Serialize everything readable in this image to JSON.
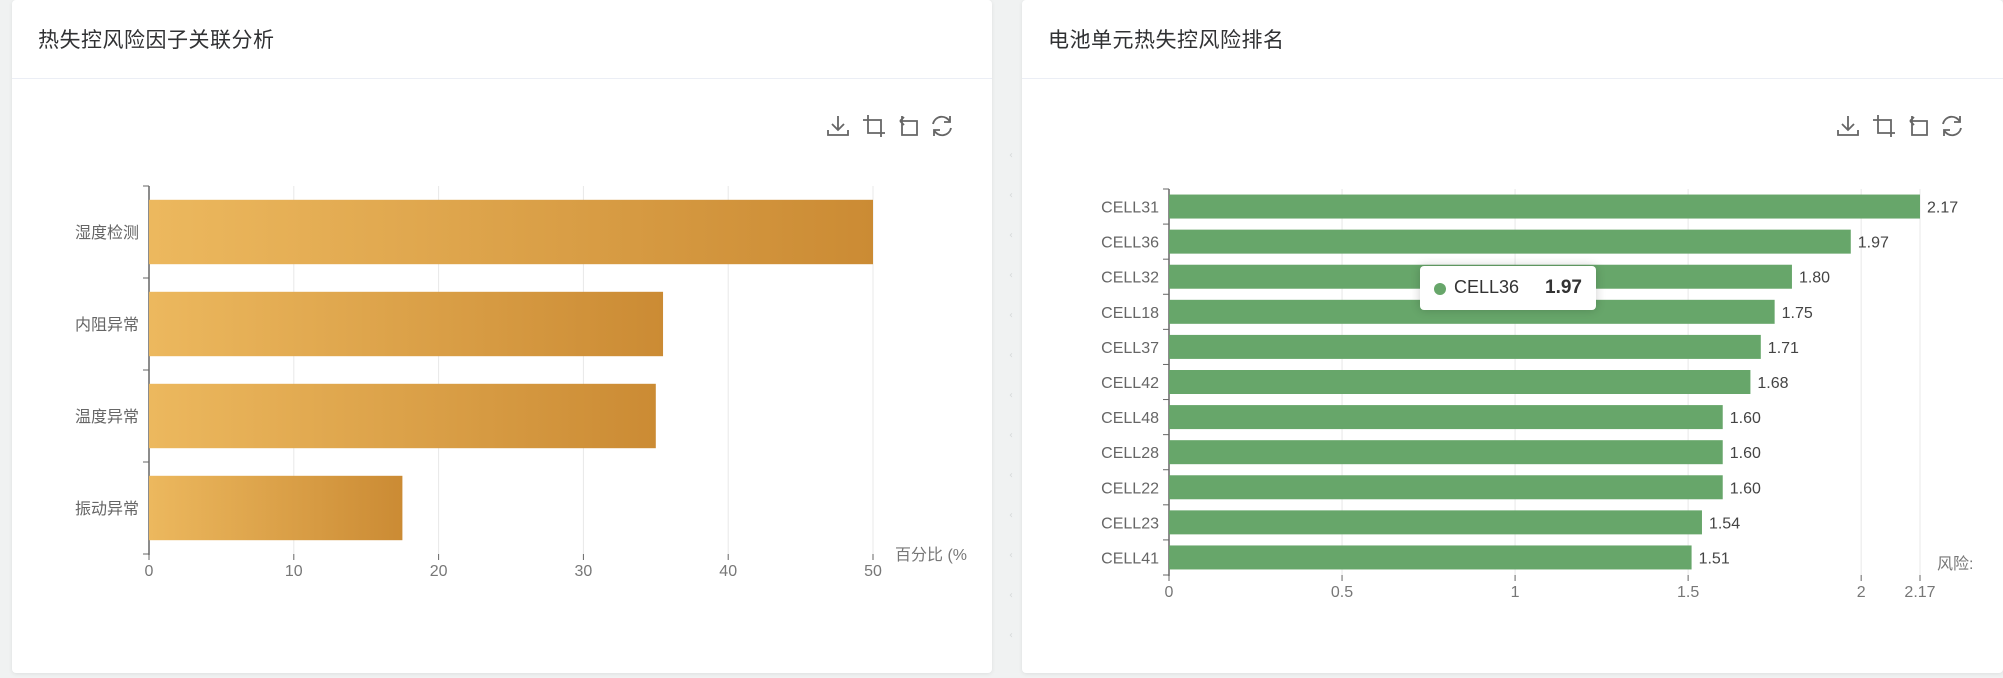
{
  "panels": [
    {
      "title": "热失控风险因子关联分析"
    },
    {
      "title": "电池单元热失控风险排名"
    }
  ],
  "toolbar_icons": [
    "download-icon",
    "data-zoom-icon",
    "zoom-reset-icon",
    "restore-icon"
  ],
  "tooltip": {
    "name": "CELL36",
    "value": "1.97",
    "color": "#67a66a"
  },
  "chart_data": [
    {
      "type": "bar",
      "orientation": "horizontal",
      "categories": [
        "湿度检测",
        "内阻异常",
        "温度异常",
        "振动异常"
      ],
      "values": [
        50,
        35.5,
        35,
        17.5
      ],
      "xlabel": "百分比 (%",
      "xlim": [
        0,
        50
      ],
      "xticks": [
        0,
        10,
        20,
        30,
        40,
        50
      ],
      "gradient": [
        "#ecb85e",
        "#cb8b34"
      ],
      "grid": true
    },
    {
      "type": "bar",
      "orientation": "horizontal",
      "categories": [
        "CELL31",
        "CELL36",
        "CELL32",
        "CELL18",
        "CELL37",
        "CELL42",
        "CELL48",
        "CELL28",
        "CELL22",
        "CELL23",
        "CELL41"
      ],
      "values": [
        2.17,
        1.97,
        1.8,
        1.75,
        1.71,
        1.68,
        1.6,
        1.6,
        1.6,
        1.54,
        1.51
      ],
      "value_labels": [
        "2.17",
        "1.97",
        "1.80",
        "1.75",
        "1.71",
        "1.68",
        "1.60",
        "1.60",
        "1.60",
        "1.54",
        "1.51"
      ],
      "xlabel": "风险:",
      "xlim": [
        0,
        2.17
      ],
      "xticks": [
        "0",
        "0.5",
        "1",
        "1.5",
        "2",
        "2.17"
      ],
      "color": "#67a66a",
      "grid": true
    }
  ]
}
